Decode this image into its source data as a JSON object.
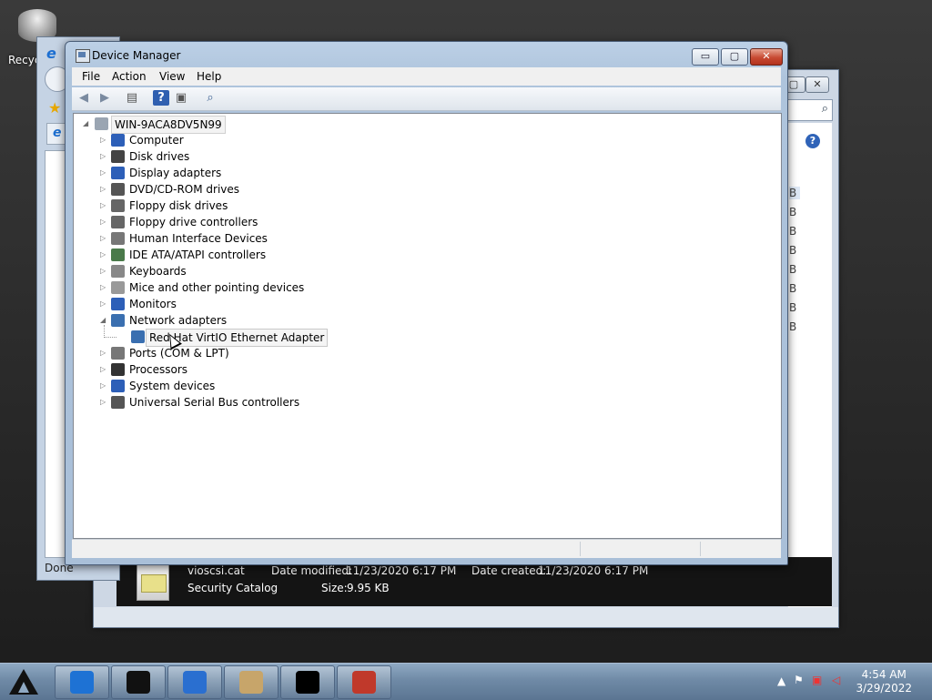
{
  "desktop": {
    "recycle_label": "Recyc"
  },
  "ie_window": {
    "status": "Done"
  },
  "explorer_window": {
    "size_unit_cells": [
      "B",
      "B",
      "B",
      "B",
      "B",
      "B",
      "B",
      "B"
    ],
    "details": {
      "filename": "vioscsi.cat",
      "type": "Security Catalog",
      "date_modified_label": "Date modified:",
      "date_modified": "11/23/2020 6:17 PM",
      "date_created_label": "Date created:",
      "date_created": "11/23/2020 6:17 PM",
      "size_label": "Size:",
      "size": "9.95 KB"
    }
  },
  "device_manager": {
    "title": "Device Manager",
    "window_buttons": {
      "minimize": "▭",
      "maximize": "▢",
      "close": "✕"
    },
    "menu": {
      "file": "File",
      "action": "Action",
      "view": "View",
      "help": "Help"
    },
    "tree": {
      "root": "WIN-9ACA8DV5N99",
      "categories": [
        {
          "label": "Computer",
          "icon": "computer-icon",
          "color": "#2d5fb8"
        },
        {
          "label": "Disk drives",
          "icon": "disk-drive-icon",
          "color": "#444444"
        },
        {
          "label": "Display adapters",
          "icon": "display-adapter-icon",
          "color": "#2d5fb8"
        },
        {
          "label": "DVD/CD-ROM drives",
          "icon": "dvd-drive-icon",
          "color": "#555555"
        },
        {
          "label": "Floppy disk drives",
          "icon": "floppy-disk-icon",
          "color": "#666666"
        },
        {
          "label": "Floppy drive controllers",
          "icon": "floppy-controller-icon",
          "color": "#666666"
        },
        {
          "label": "Human Interface Devices",
          "icon": "hid-icon",
          "color": "#777777"
        },
        {
          "label": "IDE ATA/ATAPI controllers",
          "icon": "ide-controller-icon",
          "color": "#4a7a4a"
        },
        {
          "label": "Keyboards",
          "icon": "keyboard-icon",
          "color": "#888888"
        },
        {
          "label": "Mice and other pointing devices",
          "icon": "mouse-icon",
          "color": "#999999"
        },
        {
          "label": "Monitors",
          "icon": "monitor-icon",
          "color": "#2d5fb8"
        },
        {
          "label": "Network adapters",
          "icon": "network-adapter-icon",
          "color": "#3a6fb0",
          "expanded": true
        },
        {
          "label": "Red Hat VirtIO Ethernet Adapter",
          "icon": "ethernet-adapter-icon",
          "color": "#3a6fb0",
          "child": true,
          "selected": true
        },
        {
          "label": "Ports (COM & LPT)",
          "icon": "port-icon",
          "color": "#777777"
        },
        {
          "label": "Processors",
          "icon": "processor-icon",
          "color": "#333333"
        },
        {
          "label": "System devices",
          "icon": "system-devices-icon",
          "color": "#2d5fb8"
        },
        {
          "label": "Universal Serial Bus controllers",
          "icon": "usb-icon",
          "color": "#555555"
        }
      ]
    }
  },
  "taskbar": {
    "clock_time": "4:54 AM",
    "clock_date": "3/29/2022",
    "buttons": [
      {
        "name": "internet-explorer-taskbar-button",
        "color": "#1e72d4"
      },
      {
        "name": "drive-taskbar-button",
        "color": "#111111"
      },
      {
        "name": "media-player-taskbar-button",
        "color": "#2a6fd0"
      },
      {
        "name": "paint-taskbar-button",
        "color": "#c7a56a"
      },
      {
        "name": "command-prompt-taskbar-button",
        "color": "#000000"
      },
      {
        "name": "toolbox-taskbar-button",
        "color": "#c0392b"
      }
    ]
  }
}
